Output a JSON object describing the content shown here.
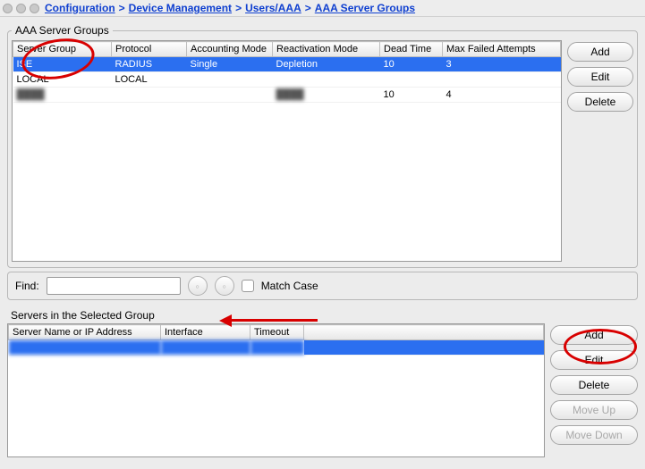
{
  "breadcrumb": {
    "configuration": "Configuration",
    "device_management": "Device Management",
    "users_aaa": "Users/AAA",
    "current": "AAA Server Groups"
  },
  "groups_legend": "AAA Server Groups",
  "groups_columns": {
    "server_group": "Server Group",
    "protocol": "Protocol",
    "accounting_mode": "Accounting Mode",
    "reactivation_mode": "Reactivation Mode",
    "dead_time": "Dead Time",
    "max_failed": "Max Failed Attempts"
  },
  "groups_rows": [
    {
      "server_group": "ISE",
      "protocol": "RADIUS",
      "accounting_mode": "Single",
      "reactivation_mode": "Depletion",
      "dead_time": "10",
      "max_failed": "3",
      "selected": true
    },
    {
      "server_group": "LOCAL",
      "protocol": "LOCAL",
      "accounting_mode": "",
      "reactivation_mode": "",
      "dead_time": "",
      "max_failed": ""
    },
    {
      "server_group": "████",
      "protocol": "",
      "accounting_mode": "",
      "reactivation_mode": "████",
      "dead_time": "10",
      "max_failed": "4",
      "redacted": true
    }
  ],
  "actions": {
    "add": "Add",
    "edit": "Edit",
    "delete": "Delete",
    "move_up": "Move Up",
    "move_down": "Move Down"
  },
  "find": {
    "label": "Find:",
    "match_case": "Match Case"
  },
  "servers_label": "Servers in the Selected Group",
  "servers_columns": {
    "server_name": "Server Name or IP Address",
    "interface": "Interface",
    "timeout": "Timeout"
  },
  "servers_rows": [
    {
      "server_name": "",
      "interface": "",
      "timeout": "",
      "selected": true,
      "redacted": true
    }
  ]
}
